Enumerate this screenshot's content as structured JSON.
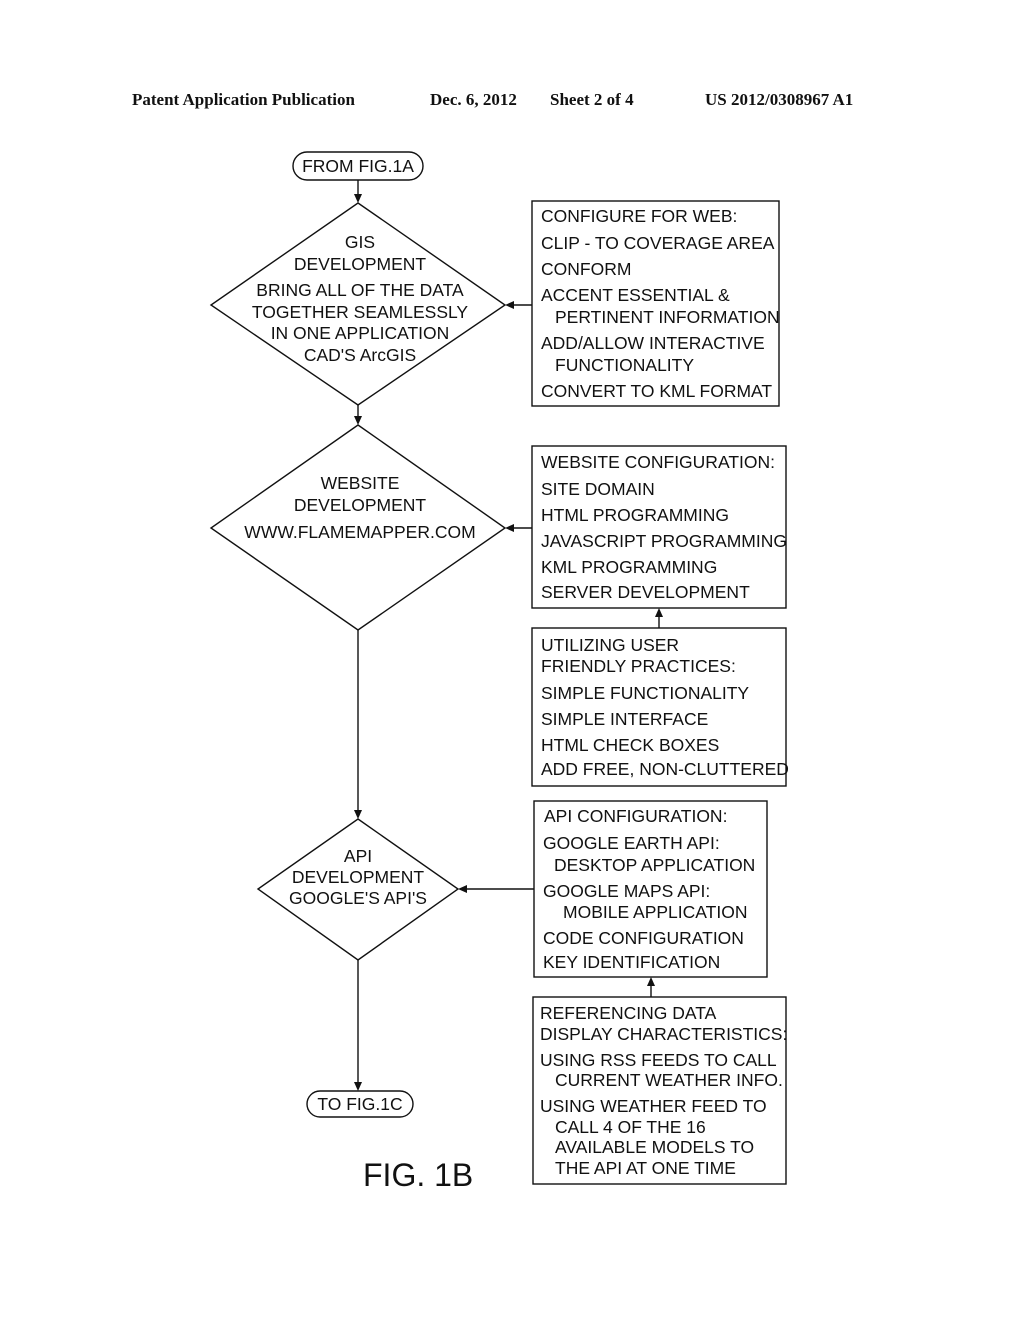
{
  "header": {
    "publication": "Patent Application Publication",
    "date": "Dec. 6, 2012",
    "sheet": "Sheet 2 of 4",
    "number": "US 2012/0308967 A1"
  },
  "diagram": {
    "start_terminal": "FROM FIG.1A",
    "end_terminal": "TO FIG.1C",
    "figure_label": "FIG. 1B",
    "decisions": [
      {
        "lines": [
          "GIS",
          "DEVELOPMENT",
          "BRING ALL OF THE DATA",
          "TOGETHER SEAMLESSLY",
          "IN ONE APPLICATION",
          "CAD'S ArcGIS"
        ]
      },
      {
        "lines": [
          "WEBSITE",
          "DEVELOPMENT",
          "WWW.FLAMEMAPPER.COM"
        ]
      },
      {
        "lines": [
          "API",
          "DEVELOPMENT",
          "GOOGLE'S API'S"
        ]
      }
    ],
    "boxes": [
      {
        "lines": [
          "CONFIGURE FOR WEB:",
          "CLIP - TO COVERAGE AREA",
          "CONFORM",
          "ACCENT ESSENTIAL &",
          "PERTINENT INFORMATION",
          "ADD/ALLOW INTERACTIVE",
          "FUNCTIONALITY",
          "CONVERT TO KML FORMAT"
        ]
      },
      {
        "lines": [
          "WEBSITE CONFIGURATION:",
          "SITE DOMAIN",
          "HTML PROGRAMMING",
          "JAVASCRIPT PROGRAMMING",
          "KML PROGRAMMING",
          "SERVER DEVELOPMENT"
        ]
      },
      {
        "lines": [
          "UTILIZING USER",
          "FRIENDLY PRACTICES:",
          "SIMPLE FUNCTIONALITY",
          "SIMPLE INTERFACE",
          "HTML CHECK BOXES",
          "ADD FREE, NON-CLUTTERED"
        ]
      },
      {
        "lines": [
          "API CONFIGURATION:",
          "GOOGLE EARTH API:",
          "DESKTOP APPLICATION",
          "GOOGLE MAPS API:",
          "MOBILE APPLICATION",
          "CODE CONFIGURATION",
          "KEY IDENTIFICATION"
        ]
      },
      {
        "lines": [
          "REFERENCING DATA",
          "DISPLAY CHARACTERISTICS:",
          "USING RSS FEEDS TO CALL",
          "CURRENT WEATHER INFO.",
          "USING WEATHER FEED TO",
          "CALL 4 OF THE 16",
          "AVAILABLE MODELS TO",
          "THE API AT ONE TIME"
        ]
      }
    ]
  }
}
